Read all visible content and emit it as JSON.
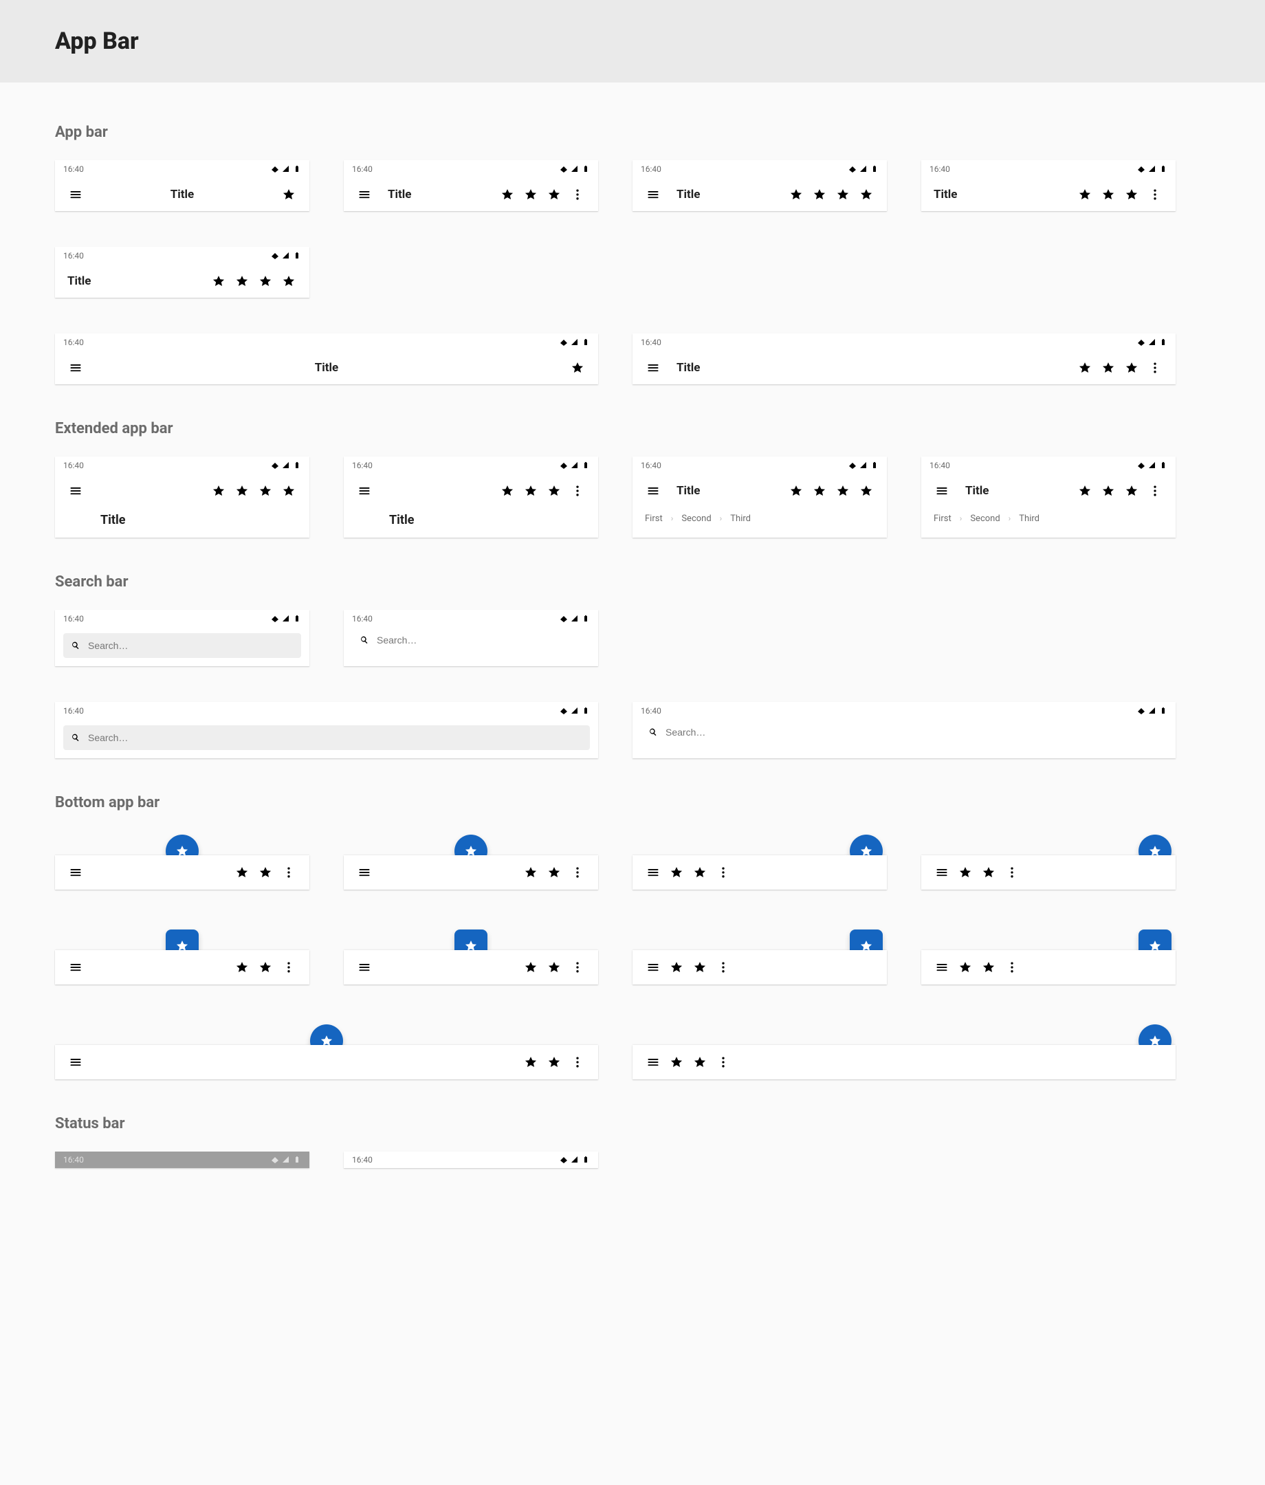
{
  "page": {
    "title": "App Bar"
  },
  "sections": {
    "app_bar": {
      "title": "App bar"
    },
    "extended_app_bar": {
      "title": "Extended app bar"
    },
    "search_bar": {
      "title": "Search bar"
    },
    "bottom_app_bar": {
      "title": "Bottom app bar"
    },
    "status_bar": {
      "title": "Status bar"
    }
  },
  "common": {
    "time": "16:40",
    "title": "Title",
    "search_placeholder": "Search…"
  },
  "breadcrumbs": {
    "first": "First",
    "second": "Second",
    "third": "Third"
  },
  "icons": {
    "menu": "menu-icon",
    "star": "star-icon",
    "overflow": "overflow-icon",
    "search": "search-icon",
    "wifi": "wifi-icon",
    "signal": "cell-icon",
    "battery": "battery-icon",
    "fab": "star-icon"
  }
}
